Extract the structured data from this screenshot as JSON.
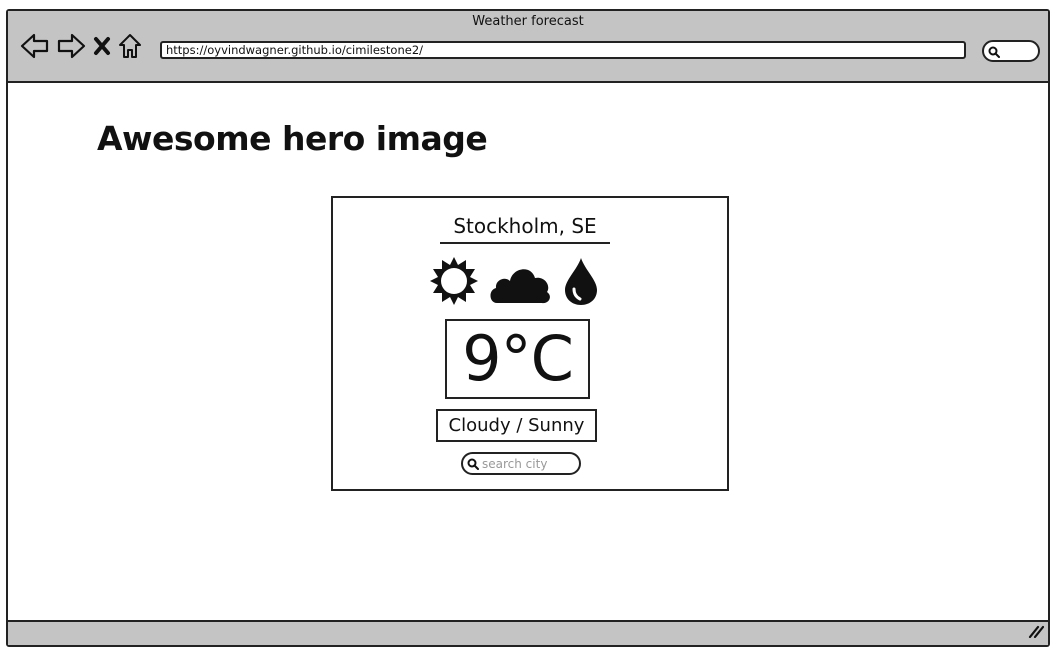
{
  "window": {
    "title": "Weather forecast",
    "url": "https://oyvindwagner.github.io/cimilestone2/"
  },
  "nav": {
    "icons": [
      "back-arrow-icon",
      "forward-arrow-icon",
      "close-x-icon",
      "home-icon"
    ]
  },
  "hero": {
    "heading": "Awesome hero image"
  },
  "weather_card": {
    "city": "Stockholm, SE",
    "icons": [
      "sun-icon",
      "cloud-icon",
      "raindrop-icon"
    ],
    "temperature": "9°C",
    "condition": "Cloudy / Sunny",
    "search_placeholder": "search city"
  }
}
